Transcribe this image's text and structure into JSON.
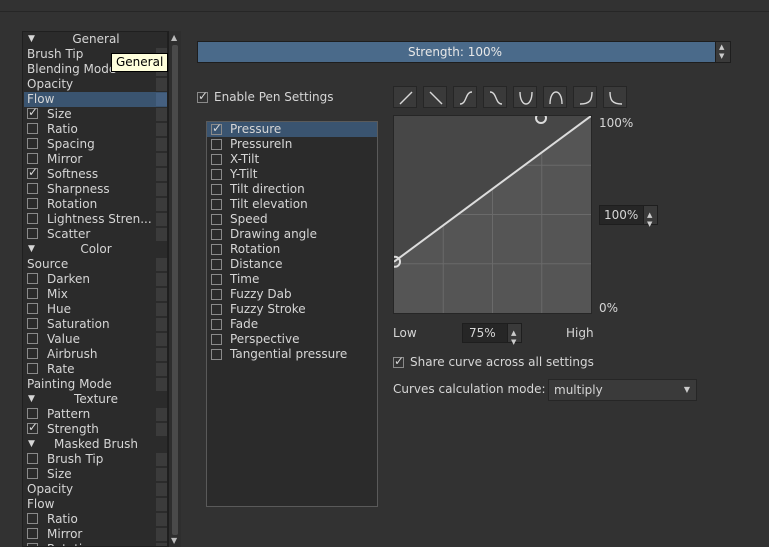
{
  "tooltip": "General",
  "left_list": [
    {
      "kind": "header",
      "label": "General"
    },
    {
      "kind": "item",
      "label": "Brush Tip"
    },
    {
      "kind": "item",
      "label": "Blending Mode"
    },
    {
      "kind": "item",
      "label": "Opacity"
    },
    {
      "kind": "item",
      "label": "Flow",
      "selected": true
    },
    {
      "kind": "check",
      "label": "Size",
      "checked": true
    },
    {
      "kind": "check",
      "label": "Ratio",
      "checked": false
    },
    {
      "kind": "check",
      "label": "Spacing",
      "checked": false
    },
    {
      "kind": "check",
      "label": "Mirror",
      "checked": false
    },
    {
      "kind": "check",
      "label": "Softness",
      "checked": true
    },
    {
      "kind": "check",
      "label": "Sharpness",
      "checked": false
    },
    {
      "kind": "check",
      "label": "Rotation",
      "checked": false
    },
    {
      "kind": "check",
      "label": "Lightness Stren...",
      "checked": false
    },
    {
      "kind": "check",
      "label": "Scatter",
      "checked": false
    },
    {
      "kind": "header",
      "label": "Color"
    },
    {
      "kind": "item",
      "label": "Source"
    },
    {
      "kind": "check",
      "label": "Darken",
      "checked": false
    },
    {
      "kind": "check",
      "label": "Mix",
      "checked": false
    },
    {
      "kind": "check",
      "label": "Hue",
      "checked": false
    },
    {
      "kind": "check",
      "label": "Saturation",
      "checked": false
    },
    {
      "kind": "check",
      "label": "Value",
      "checked": false
    },
    {
      "kind": "check",
      "label": "Airbrush",
      "checked": false
    },
    {
      "kind": "check",
      "label": "Rate",
      "checked": false
    },
    {
      "kind": "item",
      "label": "Painting Mode"
    },
    {
      "kind": "header",
      "label": "Texture"
    },
    {
      "kind": "check",
      "label": "Pattern",
      "checked": false
    },
    {
      "kind": "check",
      "label": "Strength",
      "checked": true
    },
    {
      "kind": "header",
      "label": "Masked Brush"
    },
    {
      "kind": "check",
      "label": "Brush Tip",
      "checked": false
    },
    {
      "kind": "check",
      "label": "Size",
      "checked": false
    },
    {
      "kind": "item",
      "label": "Opacity"
    },
    {
      "kind": "item",
      "label": "Flow"
    },
    {
      "kind": "check",
      "label": "Ratio",
      "checked": false
    },
    {
      "kind": "check",
      "label": "Mirror",
      "checked": false
    },
    {
      "kind": "check",
      "label": "Rotation",
      "checked": false
    }
  ],
  "strength": {
    "label": "Strength:",
    "value": "100%"
  },
  "enable_pen": {
    "label": "Enable Pen Settings",
    "checked": true
  },
  "sensors": [
    {
      "label": "Pressure",
      "checked": true,
      "selected": true
    },
    {
      "label": "PressureIn",
      "checked": false
    },
    {
      "label": "X-Tilt",
      "checked": false
    },
    {
      "label": "Y-Tilt",
      "checked": false
    },
    {
      "label": "Tilt direction",
      "checked": false
    },
    {
      "label": "Tilt elevation",
      "checked": false
    },
    {
      "label": "Speed",
      "checked": false
    },
    {
      "label": "Drawing angle",
      "checked": false
    },
    {
      "label": "Rotation",
      "checked": false
    },
    {
      "label": "Distance",
      "checked": false
    },
    {
      "label": "Time",
      "checked": false
    },
    {
      "label": "Fuzzy Dab",
      "checked": false
    },
    {
      "label": "Fuzzy Stroke",
      "checked": false
    },
    {
      "label": "Fade",
      "checked": false
    },
    {
      "label": "Perspective",
      "checked": false
    },
    {
      "label": "Tangential pressure",
      "checked": false
    }
  ],
  "curve_presets": [
    "linear-curve-icon",
    "reverse-linear-curve-icon",
    "s-curve-icon",
    "reverse-s-curve-icon",
    "u-curve-icon",
    "arch-curve-icon",
    "ease-in-curve-icon",
    "ease-out-curve-icon"
  ],
  "curve": {
    "points": [
      [
        0,
        0.26
      ],
      [
        1,
        1
      ]
    ]
  },
  "labels": {
    "top": "100%",
    "bottom": "0%",
    "low": "Low",
    "high": "High"
  },
  "max_value": "100%",
  "min_value": "75%",
  "share_curve": {
    "label": "Share curve across all settings",
    "checked": true
  },
  "calc_mode": {
    "label": "Curves calculation mode:",
    "value": "multiply"
  }
}
